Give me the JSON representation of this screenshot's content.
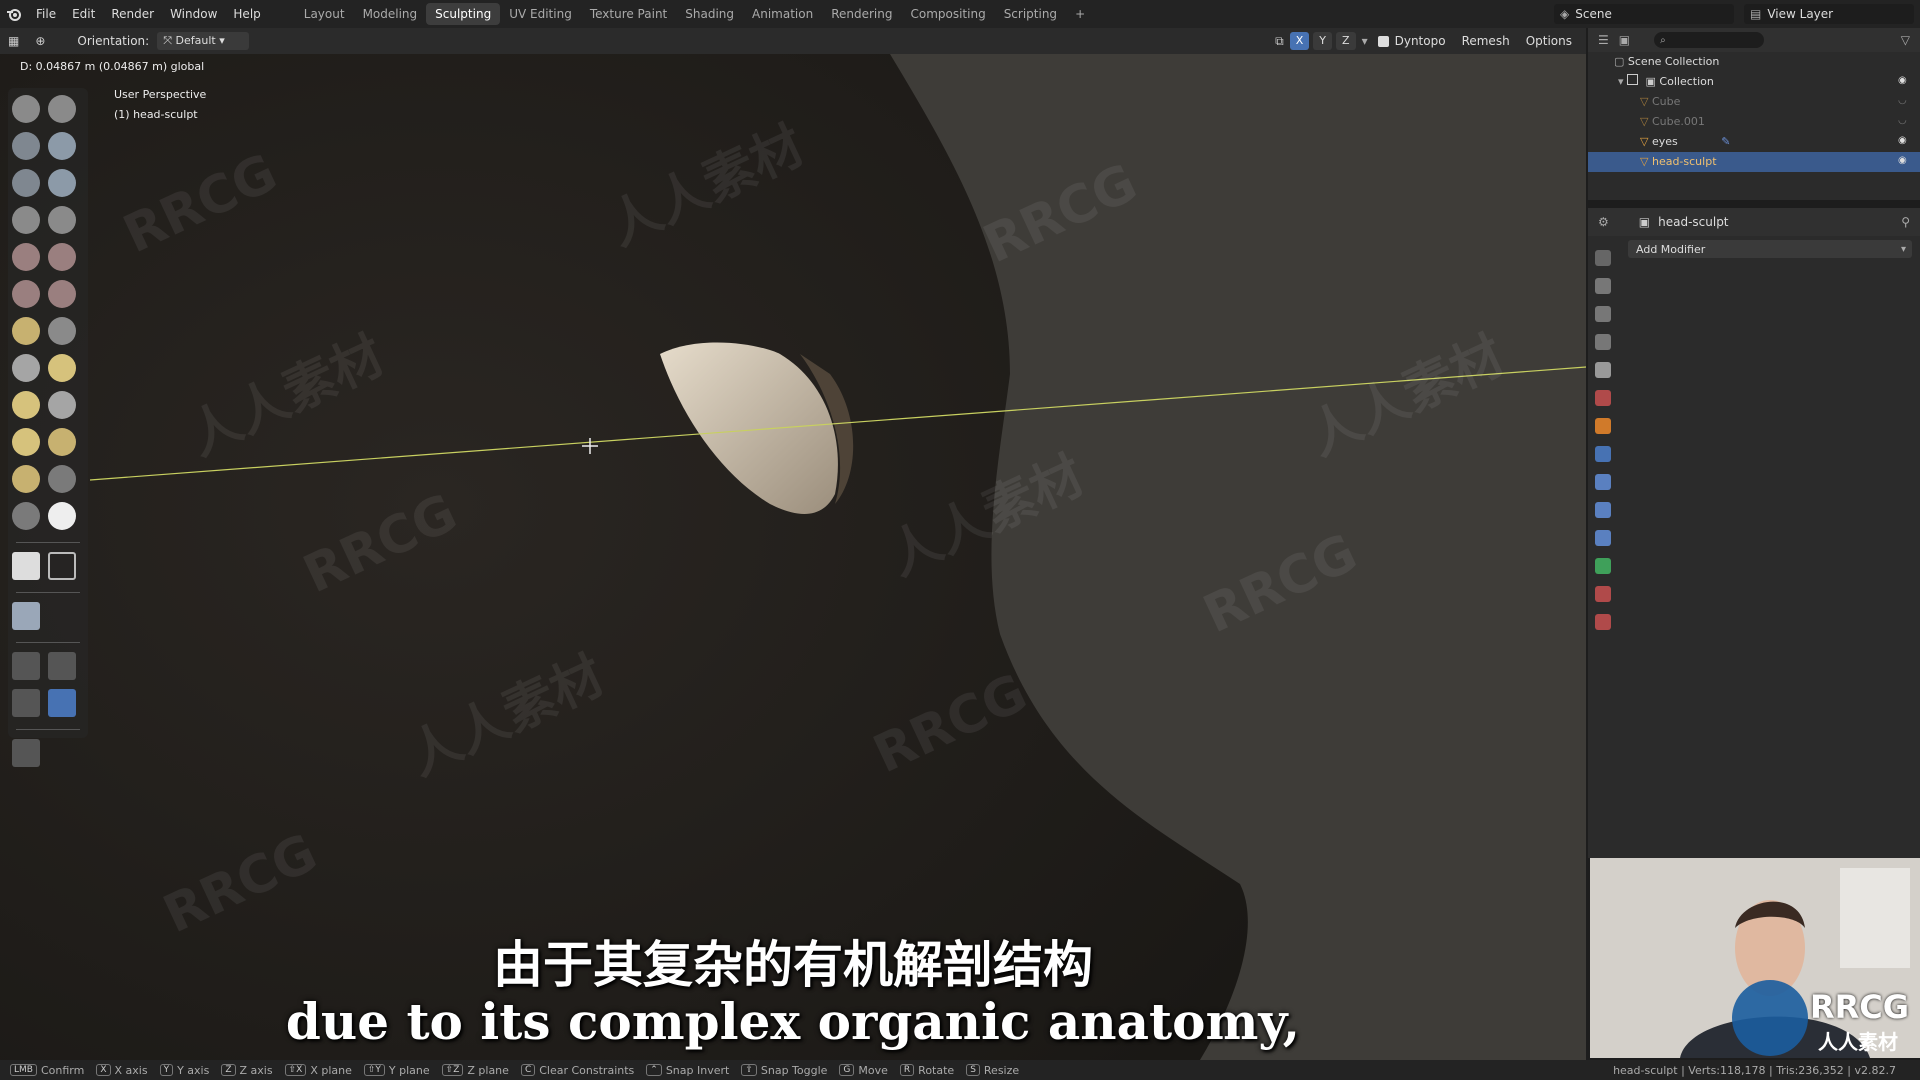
{
  "menu": [
    "File",
    "Edit",
    "Render",
    "Window",
    "Help"
  ],
  "workspaces": [
    {
      "label": "Layout",
      "active": false
    },
    {
      "label": "Modeling",
      "active": false
    },
    {
      "label": "Sculpting",
      "active": true
    },
    {
      "label": "UV Editing",
      "active": false
    },
    {
      "label": "Texture Paint",
      "active": false
    },
    {
      "label": "Shading",
      "active": false
    },
    {
      "label": "Animation",
      "active": false
    },
    {
      "label": "Rendering",
      "active": false
    },
    {
      "label": "Compositing",
      "active": false
    },
    {
      "label": "Scripting",
      "active": false
    }
  ],
  "add_workspace": "+",
  "scene_label": "Scene",
  "view_layer_label": "View Layer",
  "header": {
    "orientation_label": "Orientation:",
    "orientation_value": "Default",
    "axes": [
      "X",
      "Y",
      "Z"
    ],
    "dyntopo": "Dyntopo",
    "remesh": "Remesh",
    "options": "Options"
  },
  "viewport": {
    "distance_readout": "D: 0.04867 m (0.04867 m) global",
    "view_name": "User Perspective",
    "object_name": "(1) head-sculpt"
  },
  "outliner": {
    "root": "Scene Collection",
    "collection": "Collection",
    "items": [
      {
        "name": "Cube",
        "dim": true,
        "selected": false
      },
      {
        "name": "Cube.001",
        "dim": true,
        "selected": false
      },
      {
        "name": "eyes",
        "dim": false,
        "selected": false
      },
      {
        "name": "head-sculpt",
        "dim": false,
        "selected": true
      }
    ]
  },
  "properties": {
    "object": "head-sculpt",
    "add_modifier": "Add Modifier"
  },
  "subtitles": {
    "chinese": "由于其复杂的有机解剖结构",
    "english": "due to its complex organic anatomy,"
  },
  "statusbar": {
    "items": [
      {
        "key": "LMB",
        "label": "Confirm"
      },
      {
        "key": "X",
        "label": "X axis"
      },
      {
        "key": "Y",
        "label": "Y axis"
      },
      {
        "key": "Z",
        "label": "Z axis"
      },
      {
        "key": "⇧X",
        "label": "X plane"
      },
      {
        "key": "⇧Y",
        "label": "Y plane"
      },
      {
        "key": "⇧Z",
        "label": "Z plane"
      },
      {
        "key": "C",
        "label": "Clear Constraints"
      },
      {
        "key": "⌃",
        "label": "Snap Invert"
      },
      {
        "key": "⇧",
        "label": "Snap Toggle"
      },
      {
        "key": "G",
        "label": "Move"
      },
      {
        "key": "R",
        "label": "Rotate"
      },
      {
        "key": "S",
        "label": "Resize"
      }
    ],
    "stats": "head-sculpt | Verts:118,178 | Tris:236,352 | v2.82.7"
  },
  "watermark": {
    "latin": "RRCG",
    "chinese": "人人素材"
  },
  "colors": {
    "accent": "#4772b3",
    "grid_line": "#c8d060",
    "selected_row": "#3a5a8c"
  }
}
